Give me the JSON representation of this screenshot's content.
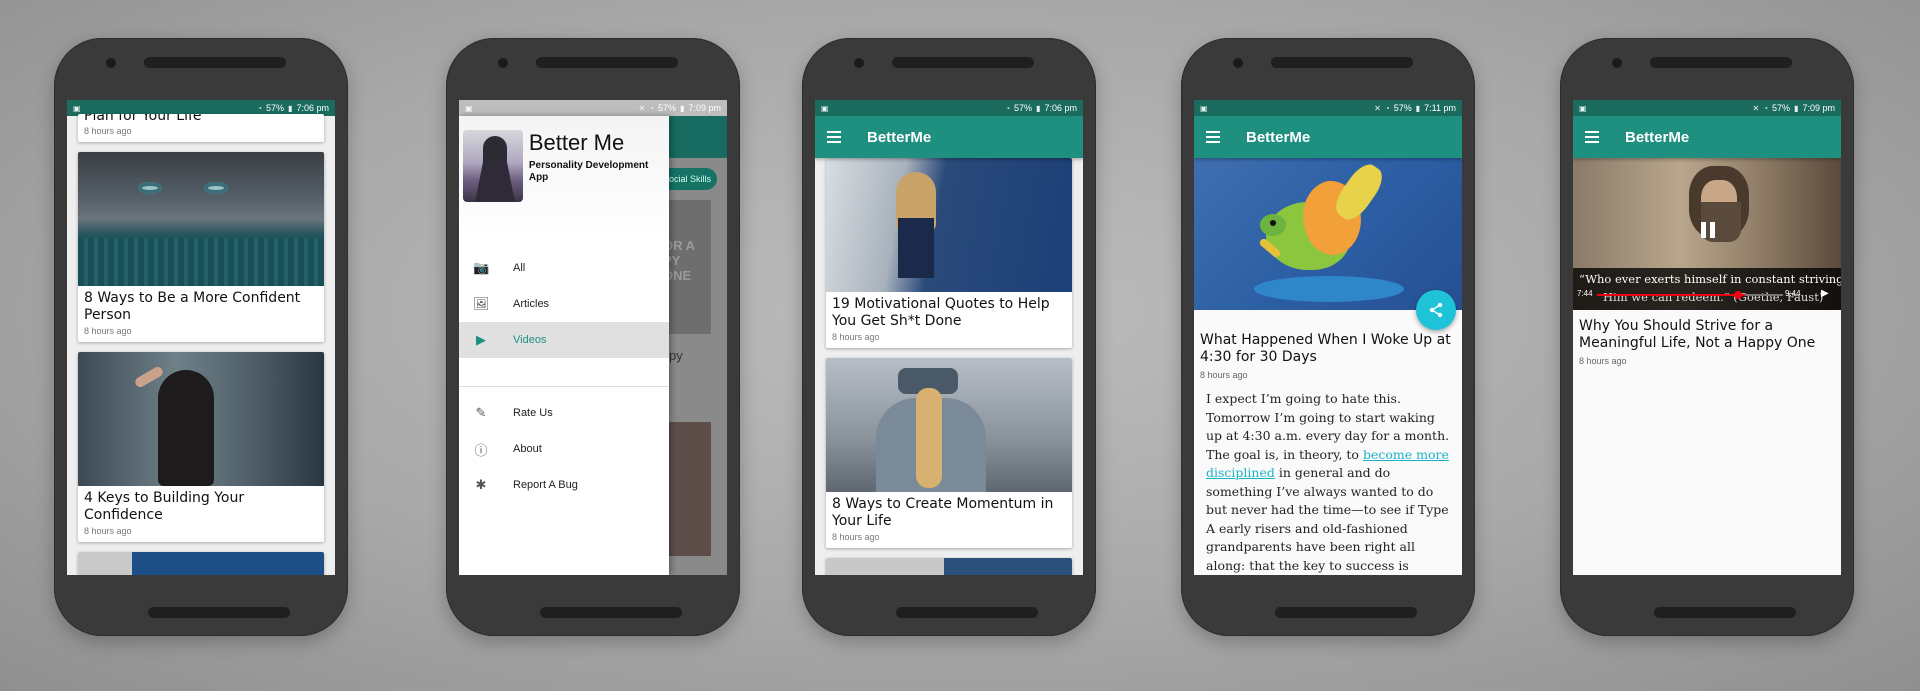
{
  "colors": {
    "primary": "#1f8f80",
    "status": "#1b6b5e",
    "accent": "#1ec3d8"
  },
  "status": {
    "battery": "57%",
    "times": [
      "7:06 pm",
      "7:09 pm",
      "7:06 pm",
      "7:11 pm",
      "7:09 pm"
    ]
  },
  "app": {
    "title": "BetterMe"
  },
  "screen1": {
    "partial_title": "Plan for Your Life",
    "partial_time": "8 hours ago",
    "cards": [
      {
        "title": "8 Ways to Be a More Confident Person",
        "time": "8 hours ago"
      },
      {
        "title": "4 Keys to Building Your Confidence",
        "time": "8 hours ago"
      }
    ]
  },
  "screen2": {
    "brand": "Better Me",
    "subtitle": "Personality Development App",
    "chip": "ocial Skills",
    "bg_text1": "OR A",
    "bg_text2": "PY ONE",
    "bg_text3": "py",
    "menu": [
      {
        "label": "All",
        "icon": "camera-icon",
        "glyph": "📷",
        "active": false
      },
      {
        "label": "Articles",
        "icon": "image-icon",
        "glyph": "🖼",
        "active": false
      },
      {
        "label": "Videos",
        "icon": "video-icon",
        "glyph": "▶",
        "active": true
      }
    ],
    "menu2": [
      {
        "label": "Rate Us",
        "icon": "rate-icon",
        "glyph": "✎"
      },
      {
        "label": "About",
        "icon": "info-icon",
        "glyph": "ⓘ"
      },
      {
        "label": "Report A Bug",
        "icon": "bug-icon",
        "glyph": "✱"
      }
    ]
  },
  "screen3": {
    "cards": [
      {
        "title": "19 Motivational Quotes to Help You Get Sh*t Done",
        "time": "8 hours ago"
      },
      {
        "title": "8 Ways to Create Momentum in Your Life",
        "time": "8 hours ago"
      }
    ]
  },
  "screen4": {
    "title": "What Happened When I Woke Up at 4:30 for 30 Days",
    "time": "8 hours ago",
    "body_before": "I expect I’m going to hate this. Tomorrow I’m going to start waking up at 4:30 a.m. every day for a month. The goal is, in theory, to ",
    "link": "become more disciplined",
    "body_after": " in general and do something I’ve always wanted to do but never had the time—to see if Type A early risers and old-fashioned grandparents have been right all along: that the key to success is"
  },
  "screen5": {
    "caption1": "“Who ever exerts himself in constant striving",
    "caption2": "Him we can redeem.” (Goethe, Faust)",
    "elapsed": "7:44",
    "duration": "9:44",
    "title": "Why You Should Strive for a Meaningful Life, Not a Happy One",
    "time": "8 hours ago"
  }
}
